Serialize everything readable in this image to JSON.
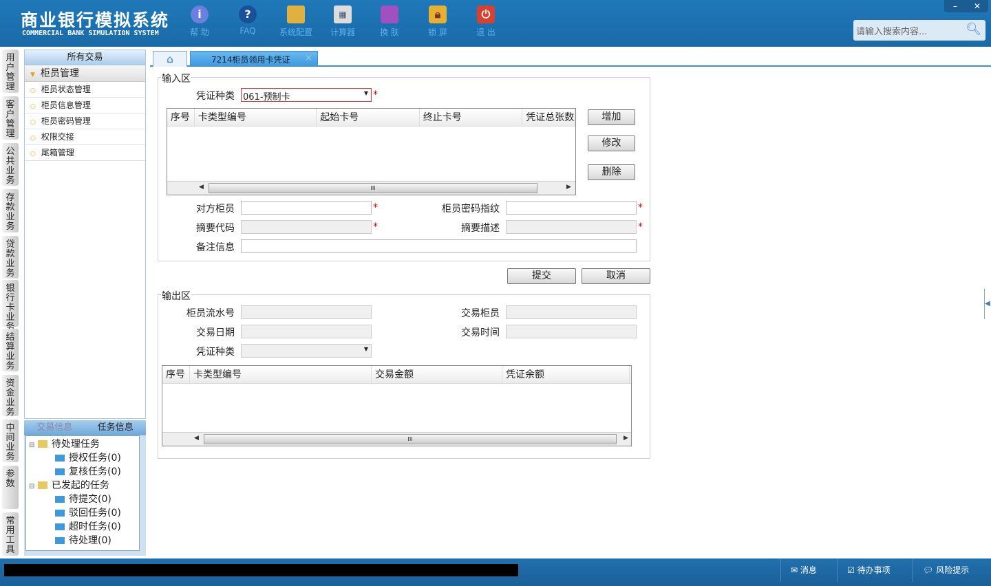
{
  "app": {
    "title": "商业银行模拟系统",
    "subtitle": "COMMERCIAL BANK SIMULATION SYSTEM"
  },
  "toolbar": [
    {
      "label": "帮 助",
      "icon": "info-icon"
    },
    {
      "label": "FAQ",
      "icon": "question-icon"
    },
    {
      "label": "系统配置",
      "icon": "toolbox-icon"
    },
    {
      "label": "计算器",
      "icon": "calculator-icon"
    },
    {
      "label": "换 肤",
      "icon": "shirt-icon"
    },
    {
      "label": "锁 屏",
      "icon": "lock-icon"
    },
    {
      "label": "退 出",
      "icon": "power-icon"
    }
  ],
  "window": {
    "minimize": "–",
    "close": "✕"
  },
  "search": {
    "placeholder": "请输入搜索内容..."
  },
  "vtabs": [
    "用户管理",
    "客户管理",
    "公共业务",
    "存款业务",
    "贷款业务",
    "银行卡业务",
    "结算业务",
    "资金业务",
    "中间业务",
    "参数",
    "常用工具"
  ],
  "leftpanel": {
    "header": "所有交易",
    "group": "柜员管理",
    "items": [
      "柜员状态管理",
      "柜员信息管理",
      "柜员密码管理",
      "权限交接",
      "尾箱管理"
    ]
  },
  "taskpanel": {
    "tabs": [
      "交易信息",
      "任务信息"
    ],
    "tree": [
      {
        "label": "待处理任务",
        "children": [
          "授权任务(0)",
          "复核任务(0)"
        ]
      },
      {
        "label": "已发起的任务",
        "children": [
          "待提交(0)",
          "驳回任务(0)",
          "超时任务(0)",
          "待处理(0)"
        ]
      }
    ]
  },
  "tabs": {
    "home": "home",
    "active": "7214柜员领用卡凭证",
    "close": "×"
  },
  "input": {
    "legend": "输入区",
    "voucher_type_label": "凭证种类",
    "voucher_type_value": "061-预制卡",
    "grid_headers": [
      "序号",
      "卡类型编号",
      "起始卡号",
      "终止卡号",
      "凭证总张数"
    ],
    "buttons": {
      "add": "增加",
      "modify": "修改",
      "delete": "删除"
    },
    "fields": {
      "other_teller": "对方柜员",
      "teller_pwd": "柜员密码指纹",
      "summary_code": "摘要代码",
      "summary_desc": "摘要描述",
      "remark": "备注信息"
    },
    "scroll_grip": "III"
  },
  "actions": {
    "submit": "提交",
    "cancel": "取消"
  },
  "output": {
    "legend": "输出区",
    "fields": {
      "serial": "柜员流水号",
      "trade_teller": "交易柜员",
      "date": "交易日期",
      "time": "交易时间",
      "voucher_type": "凭证种类"
    },
    "grid_headers": [
      "序号",
      "卡类型编号",
      "交易金额",
      "凭证余额"
    ]
  },
  "statusbar": {
    "messages": "消息",
    "todo": "待办事项",
    "risk": "风险提示"
  }
}
